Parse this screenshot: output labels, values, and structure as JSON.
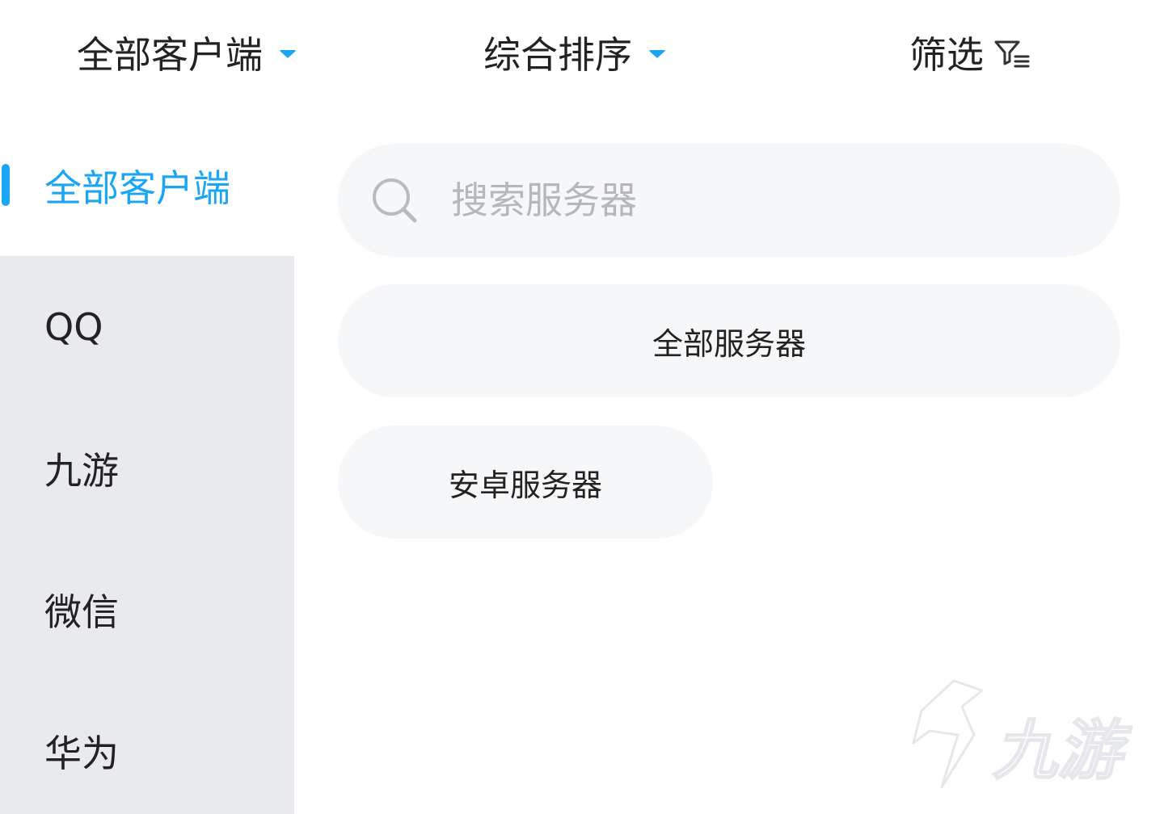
{
  "colors": {
    "accent": "#1aa5f5",
    "text": "#222222",
    "placeholder": "#b5b7bc",
    "sidebar_bg": "#e9eaed",
    "pill_bg": "#f6f7f9"
  },
  "filter_bar": {
    "client": {
      "label": "全部客户端",
      "icon": "caret-down-icon"
    },
    "sort": {
      "label": "综合排序",
      "icon": "caret-down-icon"
    },
    "filter": {
      "label": "筛选",
      "icon": "filter-icon"
    }
  },
  "sidebar": {
    "items": [
      {
        "label": "全部客户端",
        "active": true
      },
      {
        "label": "QQ",
        "active": false
      },
      {
        "label": "九游",
        "active": false
      },
      {
        "label": "微信",
        "active": false
      },
      {
        "label": "华为",
        "active": false
      }
    ]
  },
  "search": {
    "placeholder": "搜索服务器",
    "value": "",
    "icon": "search-icon"
  },
  "servers": {
    "all_label": "全部服务器",
    "android_label": "安卓服务器"
  },
  "watermark": {
    "text": "九游",
    "icon": "logo-icon"
  }
}
